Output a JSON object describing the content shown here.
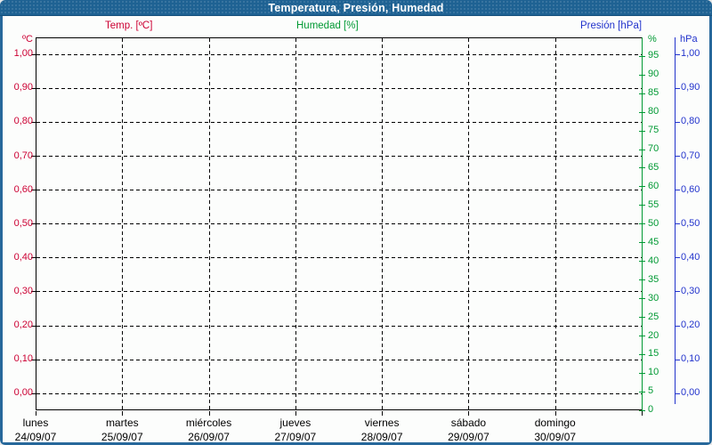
{
  "window": {
    "title": "Temperatura, Presión, Humedad"
  },
  "legend": {
    "temperature": "Temp. [ºC]",
    "humidity": "Humedad [%]",
    "pressure": "Presión [hPa]"
  },
  "axes": {
    "left": {
      "unit": "ºC",
      "ticks": [
        "1,00",
        "0,90",
        "0,80",
        "0,70",
        "0,60",
        "0,50",
        "0,40",
        "0,30",
        "0,20",
        "0,10",
        "0,00"
      ]
    },
    "humidity": {
      "unit": "%",
      "ticks": [
        "95",
        "90",
        "85",
        "80",
        "75",
        "70",
        "65",
        "60",
        "55",
        "50",
        "45",
        "40",
        "35",
        "30",
        "25",
        "20",
        "15",
        "10",
        "5",
        "0"
      ]
    },
    "pressure": {
      "unit": "hPa",
      "ticks": [
        "1,00",
        "0,90",
        "0,80",
        "0,70",
        "0,60",
        "0,50",
        "0,40",
        "0,30",
        "0,20",
        "0,10",
        "0,00"
      ]
    },
    "x": {
      "day_names": [
        "lunes",
        "martes",
        "miércoles",
        "jueves",
        "viernes",
        "sábado",
        "domingo"
      ],
      "dates": [
        "24/09/07",
        "25/09/07",
        "26/09/07",
        "27/09/07",
        "28/09/07",
        "29/09/07",
        "30/09/07"
      ]
    }
  },
  "colors": {
    "temperature": "#cc0033",
    "humidity": "#009933",
    "pressure": "#2233cc",
    "titlebar": "#1e6293",
    "window_border": "#27689b",
    "grid": "#000000"
  },
  "chart_data": {
    "type": "line",
    "title": "Temperatura, Presión, Humedad",
    "x_axis": {
      "categories_days": [
        "lunes",
        "martes",
        "miércoles",
        "jueves",
        "viernes",
        "sábado",
        "domingo"
      ],
      "categories_dates": [
        "24/09/07",
        "25/09/07",
        "26/09/07",
        "27/09/07",
        "28/09/07",
        "29/09/07",
        "30/09/07"
      ]
    },
    "y_axes": [
      {
        "name": "Temp. [ºC]",
        "side": "left",
        "min": 0.0,
        "max": 1.0,
        "tick_step": 0.1,
        "color": "#cc0033"
      },
      {
        "name": "Humedad [%]",
        "side": "right-inner",
        "min": 0,
        "max": 100,
        "tick_step": 5,
        "color": "#009933"
      },
      {
        "name": "Presión [hPa]",
        "side": "right-outer",
        "min": 0.0,
        "max": 1.0,
        "tick_step": 0.1,
        "color": "#2233cc"
      }
    ],
    "series": [
      {
        "name": "Temp. [ºC]",
        "color": "#cc0033",
        "values": []
      },
      {
        "name": "Humedad [%]",
        "color": "#009933",
        "values": []
      },
      {
        "name": "Presión [hPa]",
        "color": "#2233cc",
        "values": []
      }
    ],
    "grid": {
      "horizontal": "dashed black at every 0,10 of left axis",
      "vertical": "dashed black at every day boundary"
    },
    "legend_position": "top",
    "note": "Empty chart frame for week 24/09/07–30/09/07 — no data points are plotted"
  }
}
